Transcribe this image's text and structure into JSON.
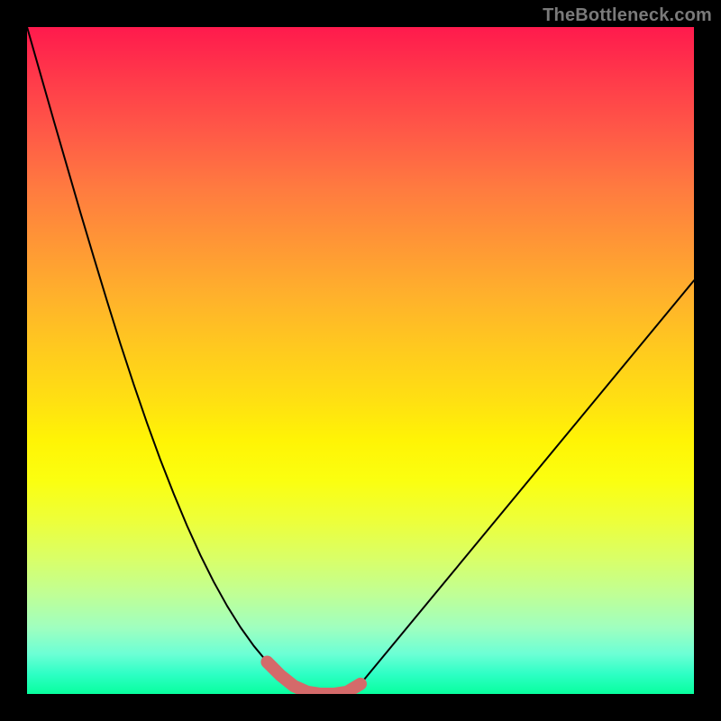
{
  "watermark": "TheBottleneck.com",
  "colors": {
    "curve": "#000000",
    "highlight": "#d46a6a",
    "gradient_top": "#ff1a4d",
    "gradient_bottom": "#08ff9e",
    "frame": "#000000"
  },
  "chart_data": {
    "type": "line",
    "title": "",
    "xlabel": "",
    "ylabel": "",
    "xlim": [
      0,
      1
    ],
    "ylim": [
      0,
      1
    ],
    "x": [
      0.0,
      0.02,
      0.04,
      0.06,
      0.08,
      0.1,
      0.12,
      0.14,
      0.16,
      0.18,
      0.2,
      0.22,
      0.24,
      0.26,
      0.28,
      0.3,
      0.32,
      0.34,
      0.36,
      0.38,
      0.4,
      0.42,
      0.44,
      0.46,
      0.48,
      0.5,
      1.0
    ],
    "values": [
      1.0,
      0.93,
      0.86,
      0.791,
      0.722,
      0.655,
      0.589,
      0.525,
      0.464,
      0.406,
      0.351,
      0.3,
      0.252,
      0.208,
      0.168,
      0.132,
      0.1,
      0.072,
      0.048,
      0.028,
      0.012,
      0.003,
      0.0,
      0.0,
      0.003,
      0.015,
      0.62
    ],
    "highlight_x_range": [
      0.36,
      0.5
    ],
    "series": [
      {
        "name": "bottleneck-curve",
        "x": [
          0.0,
          0.02,
          0.04,
          0.06,
          0.08,
          0.1,
          0.12,
          0.14,
          0.16,
          0.18,
          0.2,
          0.22,
          0.24,
          0.26,
          0.28,
          0.3,
          0.32,
          0.34,
          0.36,
          0.38,
          0.4,
          0.42,
          0.44,
          0.46,
          0.48,
          0.5,
          1.0
        ],
        "y": [
          1.0,
          0.93,
          0.86,
          0.791,
          0.722,
          0.655,
          0.589,
          0.525,
          0.464,
          0.406,
          0.351,
          0.3,
          0.252,
          0.208,
          0.168,
          0.132,
          0.1,
          0.072,
          0.048,
          0.028,
          0.012,
          0.003,
          0.0,
          0.0,
          0.003,
          0.015,
          0.62
        ]
      }
    ]
  }
}
